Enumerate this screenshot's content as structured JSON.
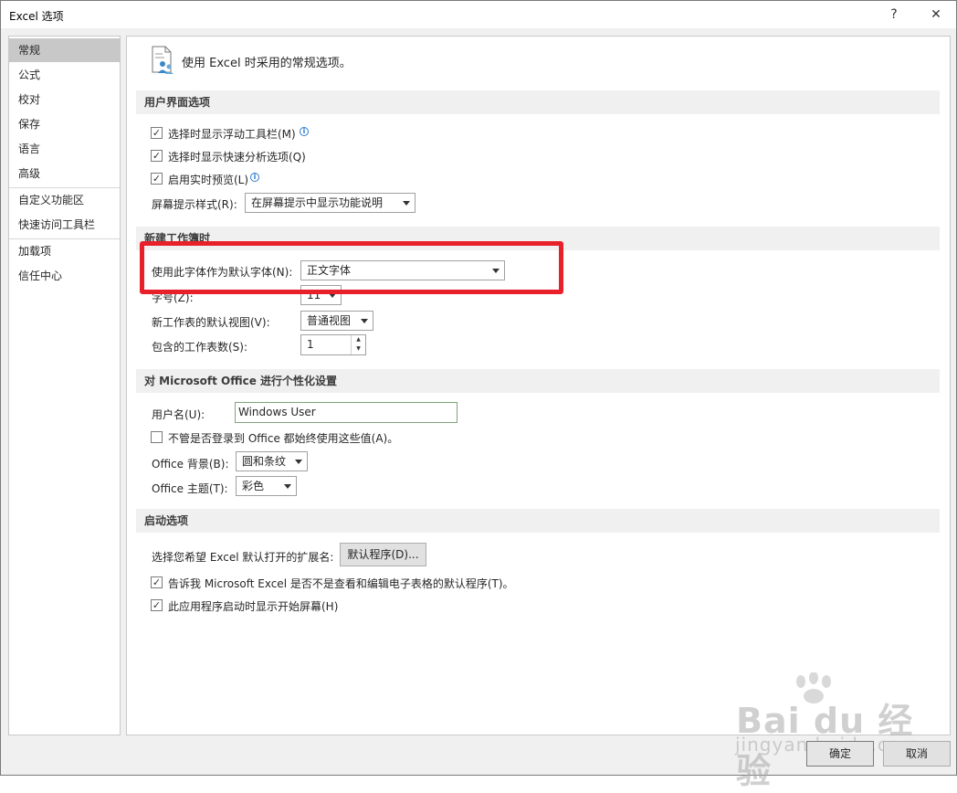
{
  "window": {
    "title": "Excel 选项",
    "help_label": "?",
    "close_label": "✕"
  },
  "nav": {
    "items": [
      "常规",
      "公式",
      "校对",
      "保存",
      "语言",
      "高级",
      "自定义功能区",
      "快速访问工具栏",
      "加载项",
      "信任中心"
    ],
    "selected": "常规"
  },
  "header": {
    "intro": "使用 Excel 时采用的常规选项。"
  },
  "ui_options": {
    "title": "用户界面选项",
    "mini_toolbar": "选择时显示浮动工具栏(M)",
    "quick_analysis": "选择时显示快速分析选项(Q)",
    "live_preview": "启用实时预览(L)",
    "screentip_label": "屏幕提示样式(R):",
    "screentip_value": "在屏幕提示中显示功能说明"
  },
  "new_workbook": {
    "title": "新建工作簿时",
    "font_label": "使用此字体作为默认字体(N):",
    "font_value": "正文字体",
    "size_label": "字号(Z):",
    "size_value": "11",
    "view_label": "新工作表的默认视图(V):",
    "view_value": "普通视图",
    "sheets_label": "包含的工作表数(S):",
    "sheets_value": "1"
  },
  "personalize": {
    "title": "对 Microsoft Office 进行个性化设置",
    "username_label": "用户名(U):",
    "username_value": "Windows User",
    "always_use": "不管是否登录到 Office 都始终使用这些值(A)。",
    "background_label": "Office 背景(B):",
    "background_value": "圆和条纹",
    "theme_label": "Office 主题(T):",
    "theme_value": "彩色"
  },
  "startup": {
    "title": "启动选项",
    "ext_label": "选择您希望 Excel 默认打开的扩展名:",
    "default_programs_button": "默认程序(D)...",
    "tell_me": "告诉我 Microsoft Excel 是否不是查看和编辑电子表格的默认程序(T)。",
    "show_start": "此应用程序启动时显示开始屏幕(H)"
  },
  "footer": {
    "ok": "确定",
    "cancel": "取消"
  },
  "watermark": {
    "brand": "Bai du 经验",
    "url": "jingyan.baidu.com"
  },
  "check_mark": "✓",
  "colors": {
    "highlight": "#e8202a",
    "selected_nav": "#c8c8c8",
    "section_bg": "#f0f0f0"
  }
}
